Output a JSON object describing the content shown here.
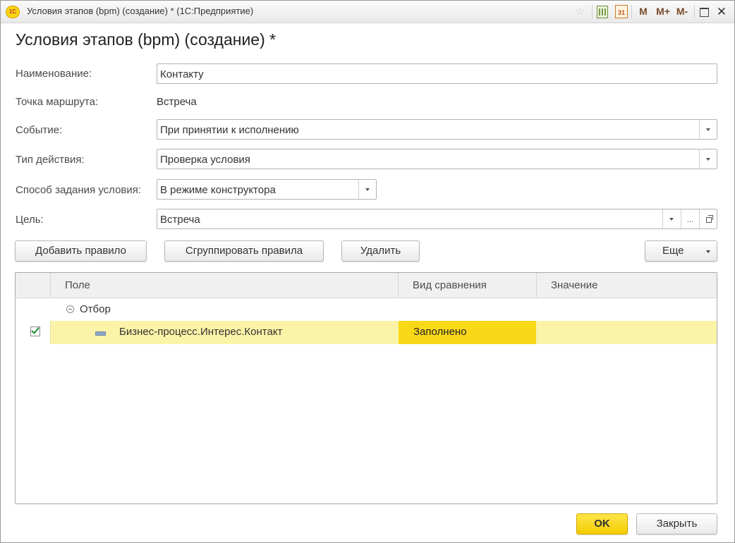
{
  "window": {
    "title": "Условия этапов (bpm) (создание) * (1С:Предприятие)",
    "logo_text": "1С",
    "calendar_day": "31",
    "memory_buttons": [
      "M",
      "M+",
      "M-"
    ]
  },
  "form": {
    "title": "Условия этапов (bpm) (создание) *",
    "fields": {
      "name": {
        "label": "Наименование:",
        "value": "Контакту"
      },
      "route_point": {
        "label": "Точка маршрута:",
        "value": "Встреча"
      },
      "event": {
        "label": "Событие:",
        "value": "При принятии к исполнению"
      },
      "action_type": {
        "label": "Тип действия:",
        "value": "Проверка условия"
      },
      "condition_method": {
        "label": "Способ задания условия:",
        "value": "В режиме конструктора"
      },
      "target": {
        "label": "Цель:",
        "value": "Встреча",
        "dots": "..."
      }
    }
  },
  "toolbar": {
    "add_rule": "Добавить правило",
    "group_rules": "Сгруппировать правила",
    "delete": "Удалить",
    "more": "Еще"
  },
  "table": {
    "columns": [
      "Поле",
      "Вид сравнения",
      "Значение"
    ],
    "group": {
      "label": "Отбор"
    },
    "rows": [
      {
        "checked": true,
        "field": "Бизнес-процесс.Интерес.Контакт",
        "comparison": "Заполнено",
        "value": ""
      }
    ]
  },
  "footer": {
    "ok": "OK",
    "close": "Закрыть"
  },
  "colors": {
    "accent_yellow": "#f9d818",
    "row_highlight": "#fbf3a8"
  }
}
